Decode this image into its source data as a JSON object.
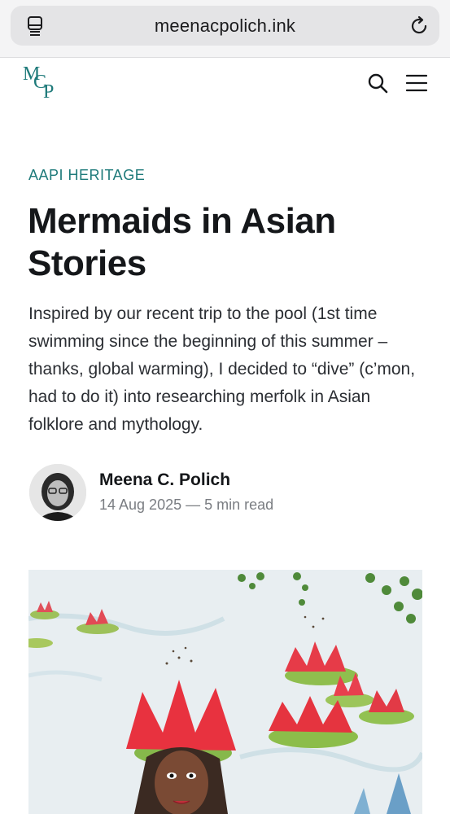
{
  "browser": {
    "url": "meenacpolich.ink",
    "icons": [
      "reader-mode-icon",
      "reload-icon"
    ]
  },
  "site": {
    "logo_letters": [
      "M",
      "C",
      "P"
    ],
    "icons": [
      "search-icon",
      "hamburger-menu-icon"
    ],
    "accent": "#1e7a7a"
  },
  "article": {
    "tag": "AAPI HERITAGE",
    "title": "Mermaids in Asian Stories",
    "excerpt": "Inspired by our recent trip to the pool (1st time swimming since the beginning of this summer – thanks, global warming), I decided to “dive” (c’mon, had to do it) into researching merfolk in Asian folklore and mythology.",
    "author": "Meena C. Polich",
    "date": "14 Aug 2025",
    "separator": " — ",
    "read_time": "5 min read"
  }
}
